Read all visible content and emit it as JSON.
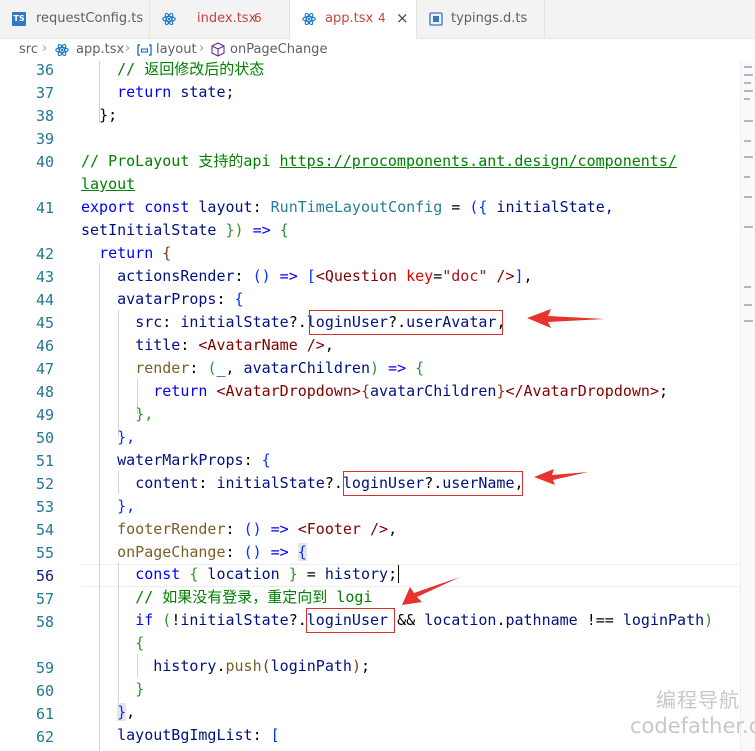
{
  "tabs": [
    {
      "label": "requestConfig.ts",
      "icon": "typescript-icon",
      "badge": "",
      "close": ""
    },
    {
      "label": "index.tsx",
      "icon": "react-icon",
      "badge": "6",
      "close": ""
    },
    {
      "label": "app.tsx",
      "icon": "react-icon",
      "badge": "4",
      "close": "×"
    },
    {
      "label": "typings.d.ts",
      "icon": "typescript-definition-icon",
      "badge": "",
      "close": ""
    }
  ],
  "breadcrumb": {
    "folder": "src",
    "file": "app.tsx",
    "symbol1": "layout",
    "symbol2": "onPageChange",
    "separator": "›"
  },
  "line_numbers": [
    "36",
    "37",
    "38",
    "39",
    "40",
    "",
    "41",
    "",
    "42",
    "43",
    "44",
    "45",
    "46",
    "47",
    "48",
    "49",
    "50",
    "51",
    "52",
    "53",
    "54",
    "55",
    "56",
    "57",
    "58",
    "",
    "59",
    "60",
    "61",
    "62"
  ],
  "code": {
    "l36": "// 返回修改后的状态",
    "l37_kw": "return",
    "l37_rest": " state;",
    "l38": "};",
    "l40_comment": "// ProLayout 支持的api ",
    "l40_link": "https://procomponents.ant.design/components/",
    "l40b_link": "layout",
    "l41a_export": "export",
    "l41a_const": "const",
    "l41a_name": "layout",
    "l41a_colon": ": ",
    "l41a_type": "RunTimeLayoutConfig",
    "l41a_eq": " = ",
    "l41a_paren": "({",
    "l41a_param": " initialState,",
    "l41b_param": "setInitialState",
    "l41b_close": " })",
    "l41b_arrow": " => ",
    "l41b_brace": "{",
    "l42_kw": "return",
    "l42_brace": "{",
    "l43_prop": "actionsRender",
    "l43_colon": ": ",
    "l43_parens": "()",
    "l43_arrow": " => ",
    "l43_br": "[",
    "l43_tag": "<Question",
    "l43_attr": " key",
    "l43_eq": "=",
    "l43_str": "\"doc\"",
    "l43_close": " />",
    "l43_br2": "]",
    "l43_end": ",",
    "l44_prop": "avatarProps",
    "l44_colon": ": ",
    "l44_brace": "{",
    "l45_prop": "src",
    "l45_colon": ": ",
    "l45_obj": "initialState",
    "l45_q": "?.",
    "l45_member": "loginUser",
    "l45_q2": "?.",
    "l45_field": "userAvatar",
    "l45_end": ",",
    "l46_prop": "title",
    "l46_colon": ": ",
    "l46_tag": "<AvatarName",
    "l46_close": " />",
    "l46_end": ",",
    "l47_prop": "render",
    "l47_colon": ": ",
    "l47_paren": "(",
    "l47_params": "_, avatarChildren",
    "l47_paren2": ")",
    "l47_arrow": " => ",
    "l47_brace": "{",
    "l48_kw": "return",
    "l48_tag": " <AvatarDropdown>",
    "l48_ob": "{",
    "l48_var": "avatarChildren",
    "l48_cb": "}",
    "l48_tag2": "</AvatarDropdown>",
    "l48_end": ";",
    "l49": "},",
    "l50": "},",
    "l51_prop": "waterMarkProps",
    "l51_colon": ": ",
    "l51_brace": "{",
    "l52_prop": "content",
    "l52_colon": ": ",
    "l52_obj": "initialState",
    "l52_q": "?.",
    "l52_member": "loginUser",
    "l52_q2": "?.",
    "l52_field": "userName",
    "l52_end": ",",
    "l53": "},",
    "l54_prop": "footerRender",
    "l54_colon": ": ",
    "l54_parens": "()",
    "l54_arrow": " => ",
    "l54_tag": "<Footer",
    "l54_close": " />",
    "l54_end": ",",
    "l55_prop": "onPageChange",
    "l55_colon": ": ",
    "l55_parens": "()",
    "l55_arrow": " => ",
    "l55_brace": "{",
    "l56_kw": "const",
    "l56_ob": " {",
    "l56_var": " location ",
    "l56_cb": "}",
    "l56_eq": " = ",
    "l56_obj": "history",
    "l56_end": ";",
    "l57": "// 如果没有登录，重定向到 logi",
    "l58_kw": "if",
    "l58_paren": " (",
    "l58_not": "!",
    "l58_obj": "initialState",
    "l58_q": "?.",
    "l58_member": "loginUser",
    "l58_and": " && ",
    "l58_loc": "location",
    "l58_dot": ".",
    "l58_path": "pathname",
    "l58_neq": " !== ",
    "l58_lp": "loginPath",
    "l58_paren2": ")",
    "l58b": "{",
    "l59_obj": "history",
    "l59_dot": ".",
    "l59_fn": "push",
    "l59_paren": "(",
    "l59_arg": "loginPath",
    "l59_paren2": ")",
    "l59_end": ";",
    "l60": "}",
    "l61_brace": "}",
    "l61_end": ",",
    "l62_prop": "layoutBgImgList",
    "l62_colon": ": ",
    "l62_br": "["
  },
  "watermark": {
    "line1": "编程导航",
    "line2": "codefather.cn"
  },
  "colors": {
    "comment": "#008000",
    "keyword": "#0000ff",
    "function": "#795e26",
    "variable": "#001080",
    "type": "#267f99",
    "string": "#a31515",
    "jsx_tag": "#800000",
    "annotation_red": "#d9302c",
    "line_number": "#237893"
  }
}
